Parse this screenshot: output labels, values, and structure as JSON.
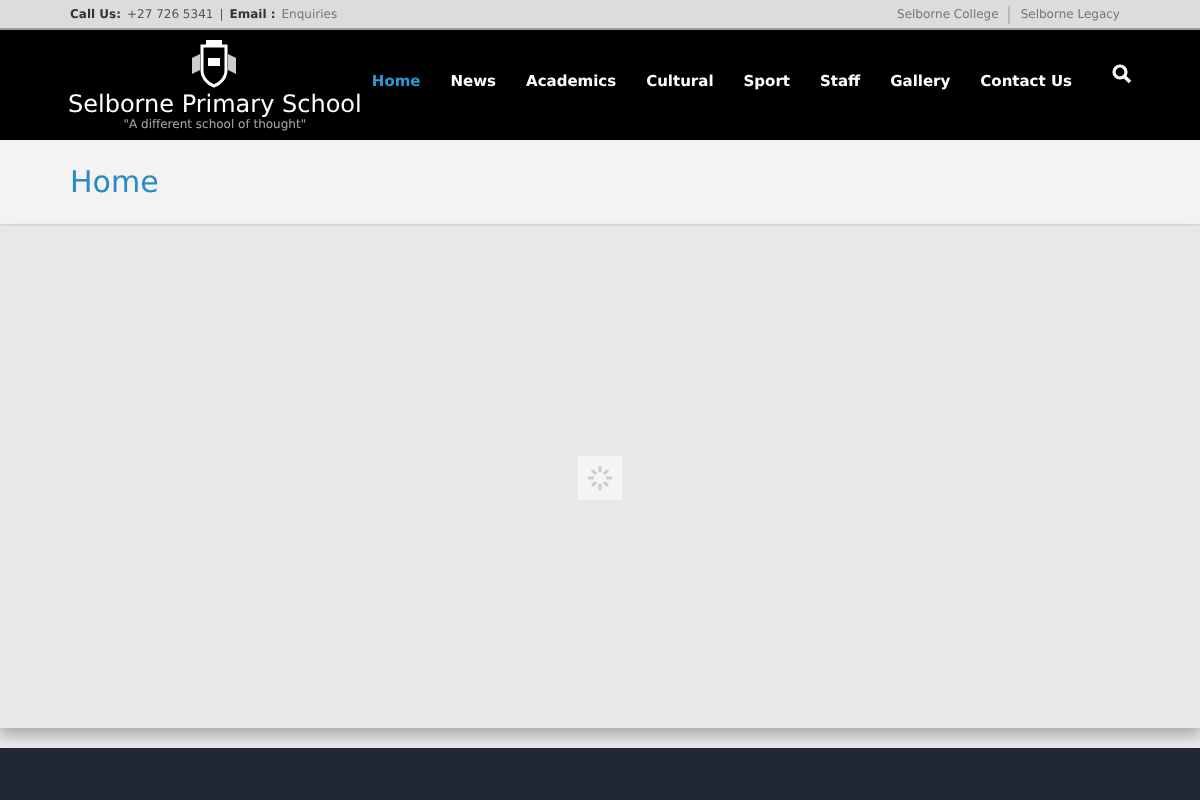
{
  "top_bar": {
    "call_label": "Call Us:",
    "phone": "+27 726 5341",
    "separator": "|",
    "email_label": "Email :",
    "email_link": "Enquiries",
    "links": [
      "Selborne College",
      "Selborne Legacy"
    ]
  },
  "header": {
    "school_name": "Selborne Primary School",
    "tagline": "\"A different school of thought\"",
    "nav": [
      {
        "label": "Home",
        "selected": true
      },
      {
        "label": "News",
        "selected": false
      },
      {
        "label": "Academics",
        "selected": false
      },
      {
        "label": "Cultural",
        "selected": false
      },
      {
        "label": "Sport",
        "selected": false
      },
      {
        "label": "Staff",
        "selected": false
      },
      {
        "label": "Gallery",
        "selected": false
      },
      {
        "label": "Contact Us",
        "selected": false
      }
    ]
  },
  "page_title": "Home"
}
